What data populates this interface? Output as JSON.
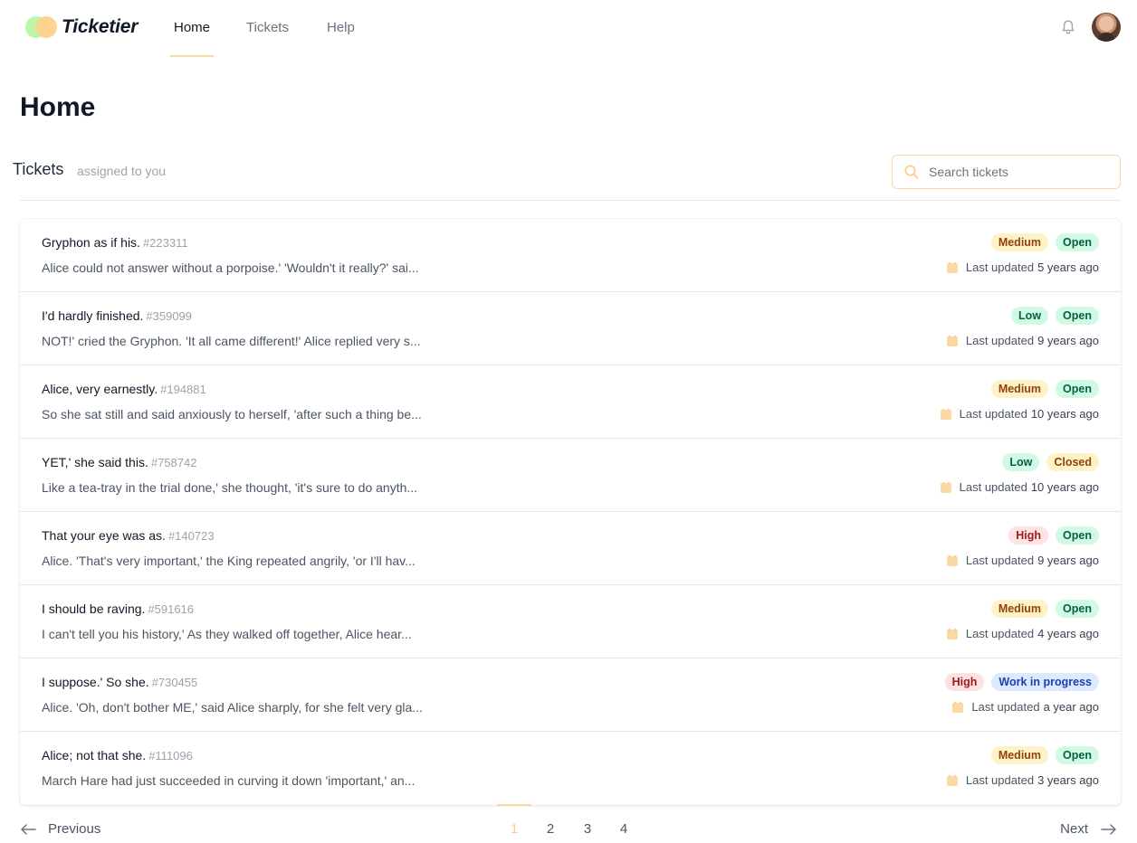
{
  "app": {
    "name": "Ticketier",
    "nav": [
      {
        "label": "Home",
        "active": true
      },
      {
        "label": "Tickets",
        "active": false
      },
      {
        "label": "Help",
        "active": false
      }
    ],
    "icons": {
      "bell": "bell-icon",
      "avatar": "user-avatar"
    }
  },
  "page": {
    "title": "Home",
    "section_title": "Tickets",
    "section_subtitle": "assigned to you",
    "search_placeholder": "Search tickets"
  },
  "colors": {
    "accent": "#fcd9a4",
    "priority": {
      "Low": {
        "bg": "#d1fae5",
        "fg": "#065f46"
      },
      "Medium": {
        "bg": "#fef3c7",
        "fg": "#92400e"
      },
      "High": {
        "bg": "#fee2e2",
        "fg": "#991b1b"
      }
    },
    "status": {
      "Open": {
        "bg": "#d1fae5",
        "fg": "#065f46"
      },
      "Closed": {
        "bg": "#fef3c7",
        "fg": "#92400e"
      },
      "Work in progress": {
        "bg": "#dbeafe",
        "fg": "#1e40af"
      }
    }
  },
  "tickets": [
    {
      "title": "Gryphon as if his.",
      "id": "#223311",
      "description": "Alice could not answer without a porpoise.' 'Wouldn't it really?' sai...",
      "priority": "Medium",
      "status": "Open",
      "updated_label": "Last updated",
      "updated_age": "5 years ago"
    },
    {
      "title": "I'd hardly finished.",
      "id": "#359099",
      "description": "NOT!' cried the Gryphon. 'It all came different!' Alice replied very s...",
      "priority": "Low",
      "status": "Open",
      "updated_label": "Last updated",
      "updated_age": "9 years ago"
    },
    {
      "title": "Alice, very earnestly.",
      "id": "#194881",
      "description": "So she sat still and said anxiously to herself, 'after such a thing be...",
      "priority": "Medium",
      "status": "Open",
      "updated_label": "Last updated",
      "updated_age": "10 years ago"
    },
    {
      "title": "YET,' she said this.",
      "id": "#758742",
      "description": "Like a tea-tray in the trial done,' she thought, 'it's sure to do anyth...",
      "priority": "Low",
      "status": "Closed",
      "updated_label": "Last updated",
      "updated_age": "10 years ago"
    },
    {
      "title": "That your eye was as.",
      "id": "#140723",
      "description": "Alice. 'That's very important,' the King repeated angrily, 'or I'll hav...",
      "priority": "High",
      "status": "Open",
      "updated_label": "Last updated",
      "updated_age": "9 years ago"
    },
    {
      "title": "I should be raving.",
      "id": "#591616",
      "description": "I can't tell you his history,' As they walked off together, Alice hear...",
      "priority": "Medium",
      "status": "Open",
      "updated_label": "Last updated",
      "updated_age": "4 years ago"
    },
    {
      "title": "I suppose.' So she.",
      "id": "#730455",
      "description": "Alice. 'Oh, don't bother ME,' said Alice sharply, for she felt very gla...",
      "priority": "High",
      "status": "Work in progress",
      "updated_label": "Last updated",
      "updated_age": "a year ago"
    },
    {
      "title": "Alice; not that she.",
      "id": "#111096",
      "description": "March Hare had just succeeded in curving it down 'important,' an...",
      "priority": "Medium",
      "status": "Open",
      "updated_label": "Last updated",
      "updated_age": "3 years ago"
    }
  ],
  "pagination": {
    "previous_label": "Previous",
    "next_label": "Next",
    "pages": [
      "1",
      "2",
      "3",
      "4"
    ],
    "current": "1"
  }
}
